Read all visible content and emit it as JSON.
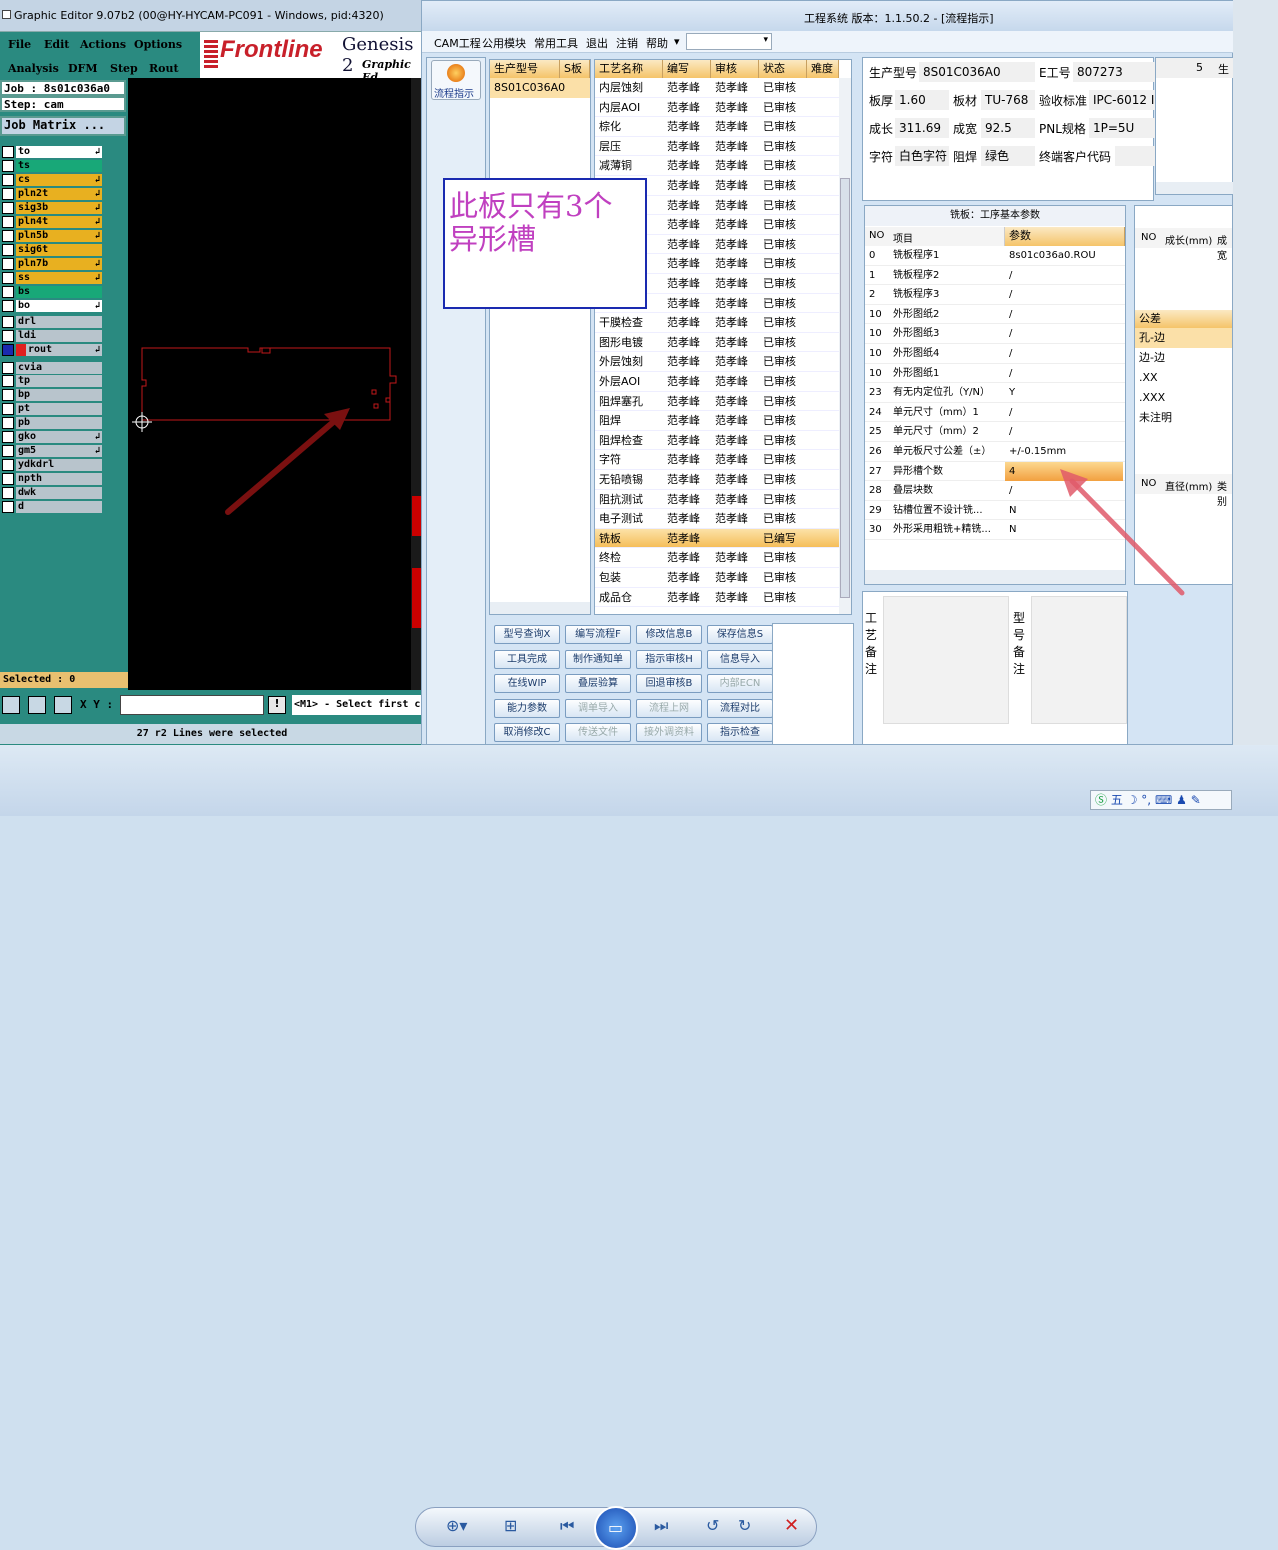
{
  "genesis": {
    "title": "Graphic Editor 9.07b2 (00@HY-HYCAM-PC091 - Windows, pid:4320)",
    "menu": [
      "File",
      "Edit",
      "Actions",
      "Options",
      "Analysis",
      "DFM",
      "Step",
      "Rout"
    ],
    "logo": "Frontline",
    "logo_product": "Genesis 2",
    "logo_sub": "Graphic Ed",
    "job": "Job : 8s01c036a0",
    "step": "Step: cam",
    "job_matrix": "Job Matrix ...",
    "layers": [
      {
        "name": "to",
        "color": "#ffffff",
        "arrow": true
      },
      {
        "name": "ts",
        "color": "#18a878",
        "arrow": false
      },
      {
        "name": "cs",
        "color": "#e8b020",
        "arrow": true
      },
      {
        "name": "pln2t",
        "color": "#e8b020",
        "arrow": true
      },
      {
        "name": "sig3b",
        "color": "#e8b020",
        "arrow": true
      },
      {
        "name": "pln4t",
        "color": "#e8b020",
        "arrow": true
      },
      {
        "name": "pln5b",
        "color": "#e8b020",
        "arrow": true
      },
      {
        "name": "sig6t",
        "color": "#e8b020",
        "arrow": false
      },
      {
        "name": "pln7b",
        "color": "#e8b020",
        "arrow": true
      },
      {
        "name": "ss",
        "color": "#e8b020",
        "arrow": true
      },
      {
        "name": "bs",
        "color": "#18a878",
        "arrow": false
      },
      {
        "name": "bo",
        "color": "#ffffff",
        "arrow": true
      },
      {
        "name": "drl",
        "color": "#b8c4cc",
        "arrow": false
      },
      {
        "name": "ldi",
        "color": "#b8c4cc",
        "arrow": false
      },
      {
        "name": "rout",
        "color": "#b8c4cc",
        "arrow": true
      },
      {
        "name": "cvia",
        "color": "#b8c4cc",
        "arrow": false
      },
      {
        "name": "tp",
        "color": "#b8c4cc",
        "arrow": false
      },
      {
        "name": "bp",
        "color": "#b8c4cc",
        "arrow": false
      },
      {
        "name": "pt",
        "color": "#b8c4cc",
        "arrow": false
      },
      {
        "name": "pb",
        "color": "#b8c4cc",
        "arrow": false
      },
      {
        "name": "gko",
        "color": "#b8c4cc",
        "arrow": true
      },
      {
        "name": "gm5",
        "color": "#b8c4cc",
        "arrow": true
      },
      {
        "name": "ydkdrl",
        "color": "#b8c4cc",
        "arrow": false
      },
      {
        "name": "npth",
        "color": "#b8c4cc",
        "arrow": false
      },
      {
        "name": "dwk",
        "color": "#b8c4cc",
        "arrow": false
      },
      {
        "name": "d",
        "color": "#b8c4cc",
        "arrow": false
      }
    ],
    "selected": "Selected : 0",
    "xy_label": "X Y :",
    "prompt": "<M1> - Select first c",
    "message": "27 r2 Lines were selected"
  },
  "app": {
    "title": "工程系统   版本：1.1.50.2 - [流程指示]",
    "menu": [
      "CAM工程",
      "公用模块",
      "常用工具",
      "退出",
      "注销",
      "帮助"
    ],
    "side_button": "流程指示",
    "model_table": {
      "headers": [
        "生产型号",
        "S板"
      ],
      "rows": [
        [
          "8S01C036A0",
          ""
        ]
      ]
    },
    "process_table": {
      "headers": [
        "工艺名称",
        "编写",
        "审核",
        "状态",
        "难度"
      ],
      "rows": [
        [
          "内层蚀刻",
          "范孝峰",
          "范孝峰",
          "已审核"
        ],
        [
          "内层AOI",
          "范孝峰",
          "范孝峰",
          "已审核"
        ],
        [
          "棕化",
          "范孝峰",
          "范孝峰",
          "已审核"
        ],
        [
          "层压",
          "范孝峰",
          "范孝峰",
          "已审核"
        ],
        [
          "减薄铜",
          "范孝峰",
          "范孝峰",
          "已审核"
        ],
        [
          "",
          "范孝峰",
          "范孝峰",
          "已审核"
        ],
        [
          "",
          "范孝峰",
          "范孝峰",
          "已审核"
        ],
        [
          "",
          "范孝峰",
          "范孝峰",
          "已审核"
        ],
        [
          "板",
          "范孝峰",
          "范孝峰",
          "已审核"
        ],
        [
          "",
          "范孝峰",
          "范孝峰",
          "已审核"
        ],
        [
          "",
          "范孝峰",
          "范孝峰",
          "已审核"
        ],
        [
          "",
          "范孝峰",
          "范孝峰",
          "已审核"
        ],
        [
          "干膜检查",
          "范孝峰",
          "范孝峰",
          "已审核"
        ],
        [
          "图形电镀",
          "范孝峰",
          "范孝峰",
          "已审核"
        ],
        [
          "外层蚀刻",
          "范孝峰",
          "范孝峰",
          "已审核"
        ],
        [
          "外层AOI",
          "范孝峰",
          "范孝峰",
          "已审核"
        ],
        [
          "阻焊塞孔",
          "范孝峰",
          "范孝峰",
          "已审核"
        ],
        [
          "阻焊",
          "范孝峰",
          "范孝峰",
          "已审核"
        ],
        [
          "阻焊检查",
          "范孝峰",
          "范孝峰",
          "已审核"
        ],
        [
          "字符",
          "范孝峰",
          "范孝峰",
          "已审核"
        ],
        [
          "无铅喷锡",
          "范孝峰",
          "范孝峰",
          "已审核"
        ],
        [
          "阻抗测试",
          "范孝峰",
          "范孝峰",
          "已审核"
        ],
        [
          "电子测试",
          "范孝峰",
          "范孝峰",
          "已审核"
        ],
        [
          "铣板",
          "范孝峰",
          "",
          "已编写"
        ],
        [
          "终检",
          "范孝峰",
          "范孝峰",
          "已审核"
        ],
        [
          "包装",
          "范孝峰",
          "范孝峰",
          "已审核"
        ],
        [
          "成品仓",
          "范孝峰",
          "范孝峰",
          "已审核"
        ]
      ],
      "selected_row": 23
    },
    "info": {
      "model_label": "生产型号",
      "model": "8S01C036A0",
      "eno_label": "E工号",
      "eno": "807273",
      "thick_label": "板厚",
      "thick": "1.60",
      "mat_label": "板材",
      "mat": "TU-768",
      "std_label": "验收标准",
      "std": "IPC-6012 I",
      "len_label": "成长",
      "len": "311.69",
      "wid_label": "成宽",
      "wid": "92.5",
      "pnl_label": "PNL规格",
      "pnl": "1P=5U",
      "char_label": "字符",
      "char": "白色字符",
      "mask_label": "阻焊",
      "mask": "绿色",
      "cust_label": "终端客户代码",
      "cust": "",
      "extra_h1": "5",
      "extra_h2": "生"
    },
    "params": {
      "title": "铣板：工序基本参数",
      "headers": [
        "NO",
        "项目",
        "参数"
      ],
      "rows": [
        [
          "0",
          "铣板程序1",
          "8s01c036a0.ROU"
        ],
        [
          "1",
          "铣板程序2",
          "/"
        ],
        [
          "2",
          "铣板程序3",
          "/"
        ],
        [
          "10",
          "外形图纸2",
          "/"
        ],
        [
          "10",
          "外形图纸3",
          "/"
        ],
        [
          "10",
          "外形图纸4",
          "/"
        ],
        [
          "10",
          "外形图纸1",
          "/"
        ],
        [
          "23",
          "有无内定位孔（Y/N）",
          "Y"
        ],
        [
          "24",
          "单元尺寸（mm）1",
          "/"
        ],
        [
          "25",
          "单元尺寸（mm）2",
          "/"
        ],
        [
          "26",
          "单元板尺寸公差（±）",
          "+/-0.15mm"
        ],
        [
          "27",
          "异形槽个数",
          "4"
        ],
        [
          "28",
          "叠层块数",
          "/"
        ],
        [
          "29",
          "钻槽位置不设计铣...",
          "N"
        ],
        [
          "30",
          "外形采用粗铣+精铣...",
          "N"
        ]
      ],
      "highlight_row": 11
    },
    "right_panel": {
      "h1": [
        "NO",
        "成长(mm)",
        "成宽"
      ],
      "tolerance_header": "公差",
      "tolerance": [
        "孔-边",
        "边-边",
        ".XX",
        ".XXX",
        "未注明"
      ],
      "h2": [
        "NO",
        "直径(mm)",
        "类别"
      ]
    },
    "notes": {
      "left": "工艺备注",
      "right": "型号备注"
    },
    "buttons": [
      [
        "型号查询X",
        "编写流程F",
        "修改信息B",
        "保存信息S"
      ],
      [
        "工具完成",
        "制作通知单",
        "指示审核H",
        "信息导入"
      ],
      [
        "在线WIP",
        "叠层验算",
        "回退审核B",
        "内部ECN"
      ],
      [
        "能力参数",
        "调单导入",
        "流程上网",
        "流程对比"
      ],
      [
        "取消修改C",
        "传送文件",
        "接外调资料",
        "指示检查"
      ]
    ],
    "disabled": [
      "内部ECN",
      "调单导入",
      "流程上网",
      "传送文件",
      "接外调资料"
    ]
  },
  "annotation": "此板只有3个异形槽",
  "colors": {
    "accent": "#f5c46a",
    "arrow": "#7a1010",
    "arrow2": "#e05a6a",
    "red": "#c00000"
  }
}
